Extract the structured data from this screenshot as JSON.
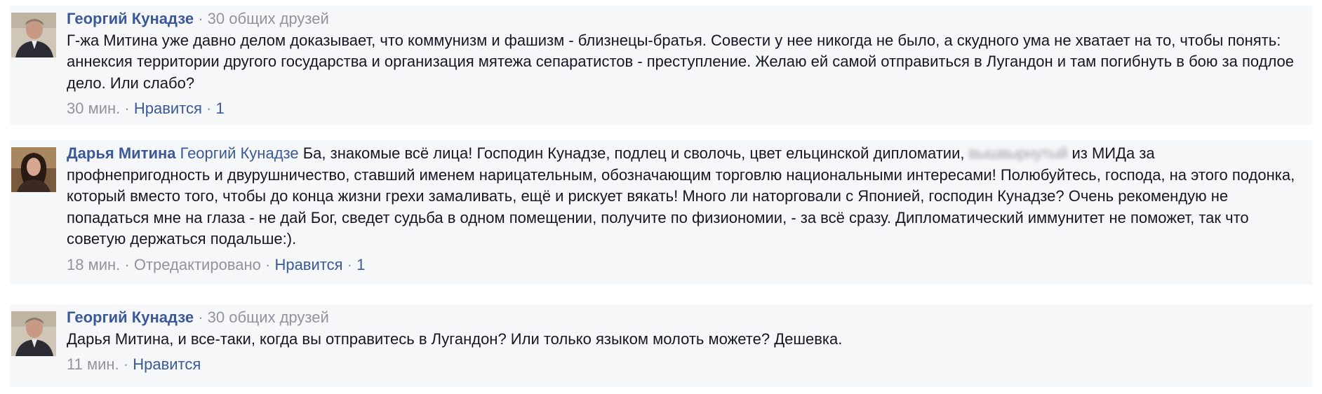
{
  "comments": [
    {
      "author": "Георгий Кунадзе",
      "separator": "·",
      "mutual_friends": "30 общих друзей",
      "text": "Г-жа Митина уже давно делом доказывает, что коммунизм и фашизм - близнецы-братья. Совести у нее никогда не было, а скудного ума не хватает на то, чтобы понять: аннексия территории другого государства и организация мятежа сепаратистов - преступление. Желаю ей самой отправиться в Лугандон и там погибнуть в бою за подлое дело. Или слабо?",
      "time": "30 мин.",
      "like_label": "Нравится",
      "like_count": "1"
    },
    {
      "author": "Дарья Митина",
      "mention": "Георгий Кунадзе",
      "text_before": "Ба, знакомые всё лица! Господин Кунадзе, подлец и сволочь, цвет ельцинской дипломатии,",
      "blurred_word": "вышвырнутый",
      "text_after": "из МИДа за профнепригодность и двурушничество, ставший именем нарицательным, обозначающим торговлю национальными интересами! Полюбуйтесь, господа, на этого подонка, который вместо того, чтобы до конца жизни грехи замаливать, ещё и рискует вякать! Много ли наторговали с Японией, господин Кунадзе? Очень рекомендую не попадаться мне на глаза - не дай Бог, сведет судьба в одном помещении, получите по физиономии, - за всё сразу. Дипломатический иммунитет не поможет, так что советую держаться подальше:).",
      "time": "18 мин.",
      "edited": "Отредактировано",
      "like_label": "Нравится",
      "like_count": "1"
    },
    {
      "author": "Георгий Кунадзе",
      "mutual_friends": "30 общих друзей",
      "text": "Дарья Митина, и все-таки, когда вы отправитесь в Лугандон? Или только языком молоть можете? Дешевка.",
      "time": "11 мин.",
      "like_label": "Нравится"
    }
  ],
  "colors": {
    "link": "#3b5998",
    "muted": "#90949c",
    "background": "#f6f7f9",
    "text": "#141823"
  },
  "icons": {
    "avatar_1": "man-portrait",
    "avatar_2": "woman-portrait",
    "avatar_3": "man-portrait"
  }
}
